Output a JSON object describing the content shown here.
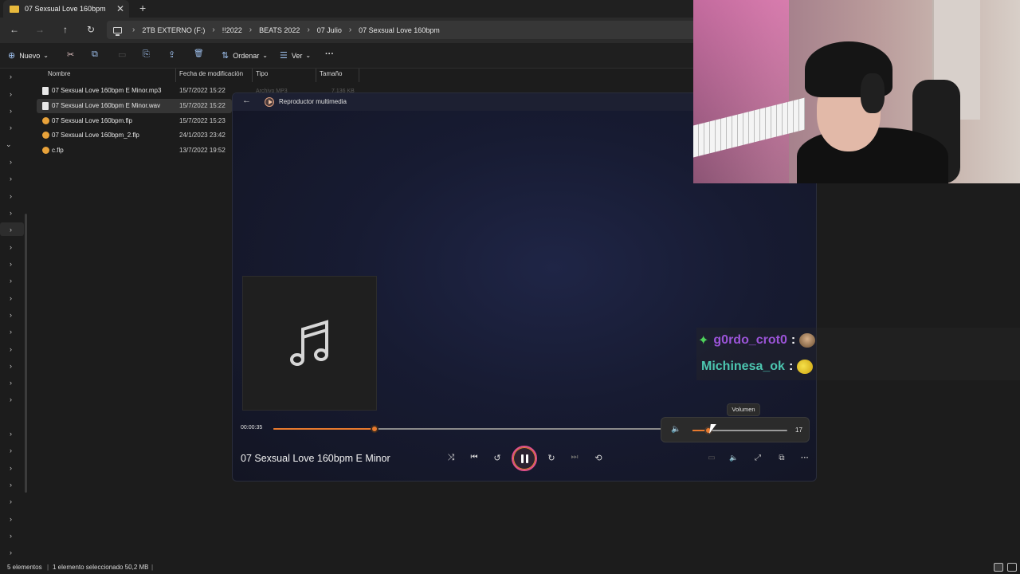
{
  "tab": {
    "title": "07 Sexsual Love 160bpm",
    "close": "✕",
    "add": "+"
  },
  "nav": {
    "back": "←",
    "forward": "→",
    "up": "↑",
    "refresh": "↻",
    "breadcrumb": [
      "2TB EXTERNO (F:)",
      "!!2022",
      "BEATS 2022",
      "07 Julio",
      "07 Sexsual Love 160bpm"
    ],
    "sep": "›"
  },
  "toolbar": {
    "new_label": "Nuevo",
    "new_icon": "⊕",
    "cut_icon": "✂",
    "copy_icon": "⧉",
    "paste_icon": "▭",
    "rename_icon": "⎘",
    "share_icon": "⇪",
    "delete_icon": "🗑",
    "sort_label": "Ordenar",
    "sort_icon": "⇅",
    "view_label": "Ver",
    "view_icon": "☰",
    "more": "···",
    "caret": "⌄"
  },
  "columns": {
    "name": "Nombre",
    "date": "Fecha de modificación",
    "type": "Tipo",
    "size": "Tamaño"
  },
  "files": [
    {
      "name": "07 Sexsual Love 160bpm E Minor.mp3",
      "date": "15/7/2022 15:22",
      "kind": "audio"
    },
    {
      "name": "07 Sexsual Love 160bpm E Minor.wav",
      "date": "15/7/2022 15:22",
      "kind": "audio"
    },
    {
      "name": "07 Sexsual Love 160bpm.flp",
      "date": "15/7/2022 15:23",
      "kind": "flp"
    },
    {
      "name": "07 Sexsual Love 160bpm_2.flp",
      "date": "24/1/2023 23:42",
      "kind": "flp"
    },
    {
      "name": "c.flp",
      "date": "13/7/2022 19:52",
      "kind": "flp"
    }
  ],
  "partial_type": "Archivo MP3",
  "partial_size": "7.136 KB",
  "player": {
    "app_name": "Reproductor multimedia",
    "back": "←",
    "elapsed": "00:00:35",
    "progress": 0.26,
    "track_title": "07 Sexsual Love 160bpm E Minor",
    "music_note": "♫",
    "shuffle": "⤨",
    "previous": "⏮",
    "rewind": "↺",
    "forward": "↻",
    "next": "⏭",
    "repeat": "⟲",
    "miniplayer": "▭",
    "volume_icon": "🔈",
    "fullscreen": "⤢",
    "cast": "⧉",
    "more": "···",
    "volume": {
      "tooltip": "Volumen",
      "value": 17,
      "icon": "🔈"
    }
  },
  "chat": [
    {
      "badge": "✦",
      "user": "g0rdo_crot0",
      "colon": ":"
    },
    {
      "user": "Michinesa_ok",
      "colon": ":"
    }
  ],
  "status": {
    "count": "5 elementos",
    "selected": "1 elemento seleccionado  50,2 MB",
    "bar": "|"
  }
}
